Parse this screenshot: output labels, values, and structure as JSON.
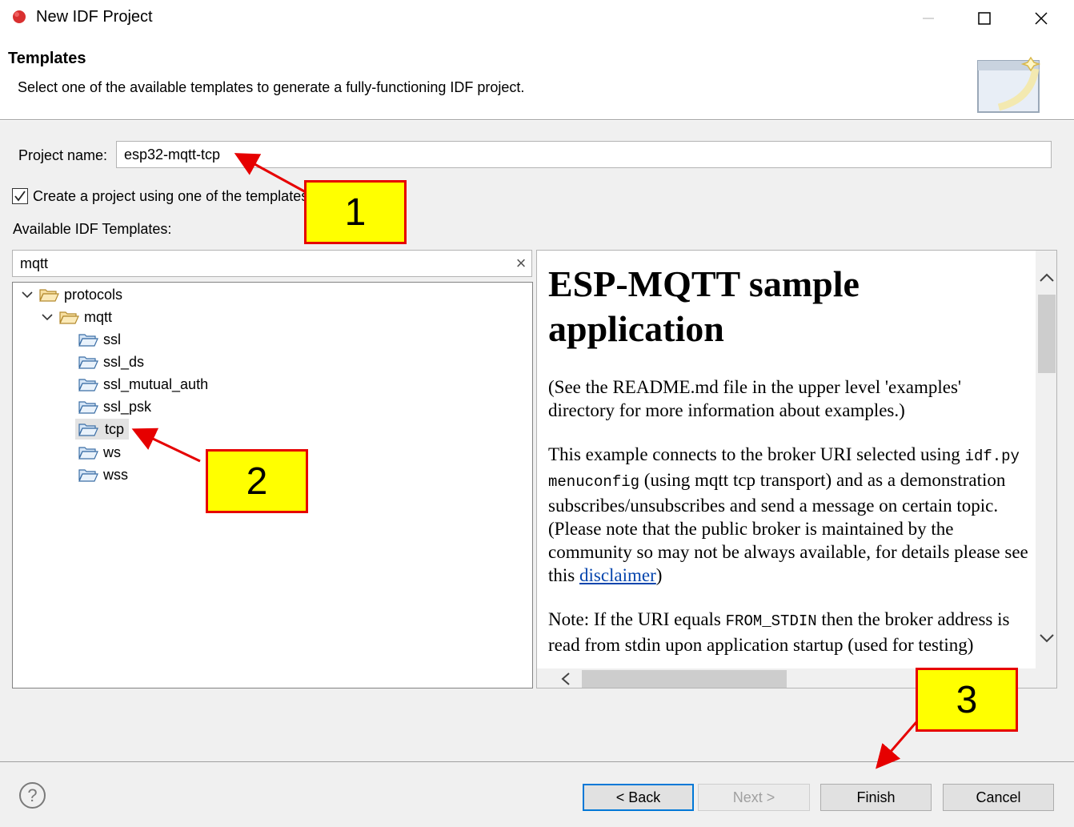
{
  "window": {
    "title": "New IDF Project"
  },
  "banner": {
    "title": "Templates",
    "description": "Select one of the available templates to generate a fully-functioning IDF project."
  },
  "form": {
    "project_name_label": "Project name:",
    "project_name_value": "esp32-mqtt-tcp",
    "use_template_label": "Create a project using one of the templates",
    "use_template_checked": true,
    "available_label": "Available IDF Templates:",
    "filter_value": "mqtt",
    "filter_clear_icon": "×"
  },
  "tree": {
    "items": [
      {
        "label": "protocols",
        "expanded": true
      },
      {
        "label": "mqtt",
        "expanded": true
      },
      {
        "label": "ssl"
      },
      {
        "label": "ssl_ds"
      },
      {
        "label": "ssl_mutual_auth"
      },
      {
        "label": "ssl_psk"
      },
      {
        "label": "tcp",
        "selected": true
      },
      {
        "label": "ws"
      },
      {
        "label": "wss"
      }
    ]
  },
  "preview": {
    "heading": "ESP-MQTT sample application",
    "para1": "(See the README.md file in the upper level 'examples' directory for more information about examples.)",
    "para2_a": "This example connects to the broker URI selected using",
    "para2_code": "idf.py menuconfig",
    "para2_b": "(using mqtt tcp transport) and as a demonstration subscribes/unsubscribes and send a message on certain topic. (Please note that the public broker is maintained by the community so may not be always available, for details please see this",
    "para2_link": "disclaimer",
    "para2_c": ")",
    "para3_a": "Note: If the URI equals",
    "para3_code": "FROM_STDIN",
    "para3_b": "then the broker address is read from stdin upon application startup (used for testing)"
  },
  "footer": {
    "help_icon": "?",
    "back_label": "< Back",
    "next_label": "Next >",
    "finish_label": "Finish",
    "cancel_label": "Cancel"
  },
  "callouts": {
    "one": "1",
    "two": "2",
    "three": "3"
  },
  "colors": {
    "callout_fill": "#ffff00",
    "callout_border": "#e60000",
    "arrow": "#e60000",
    "link": "#0645ad",
    "default_button_border": "#0078d7"
  }
}
